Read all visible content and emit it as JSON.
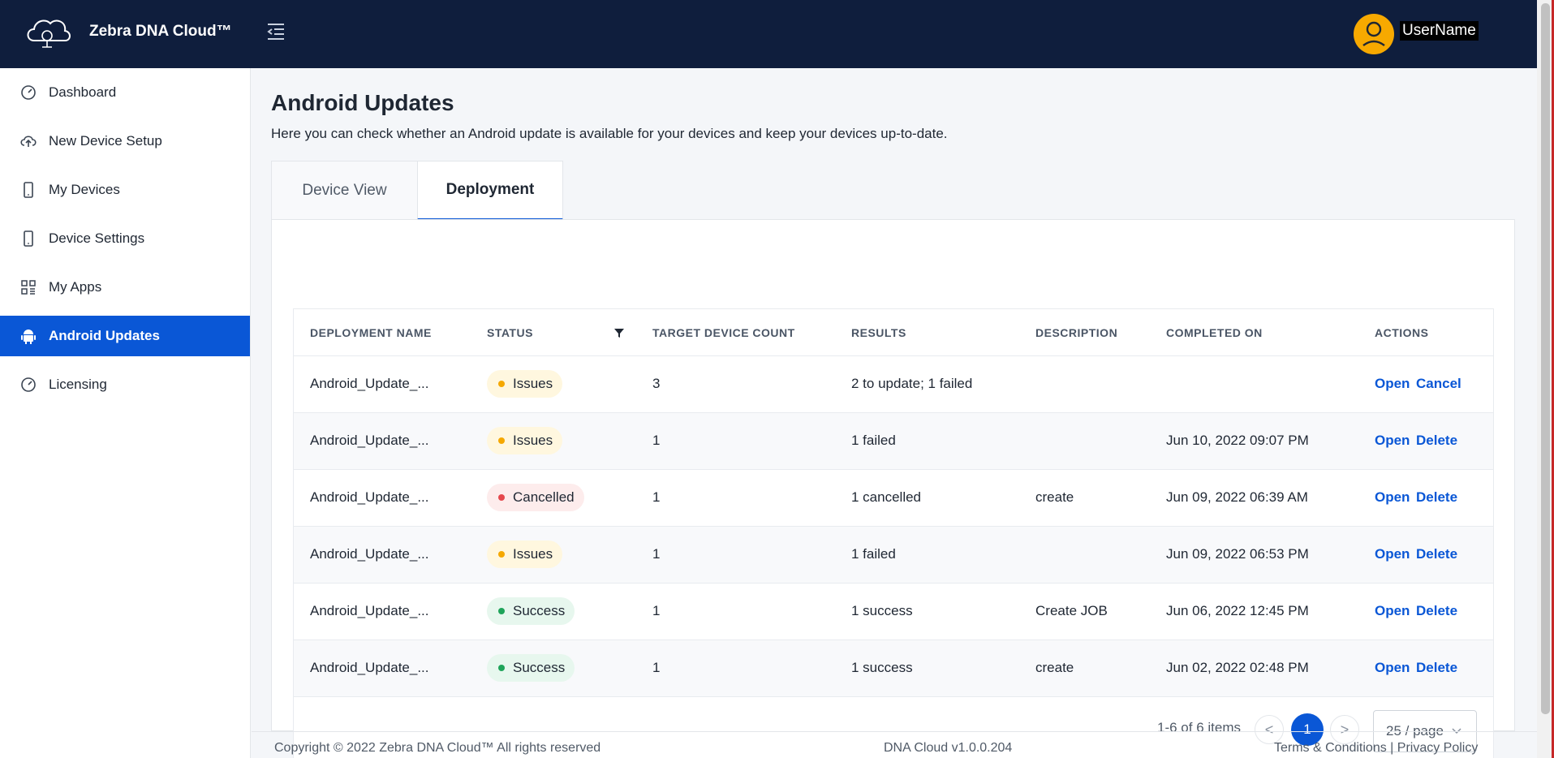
{
  "app": {
    "name": "Zebra DNA Cloud™",
    "username": "UserName"
  },
  "sidebar": {
    "items": [
      {
        "label": "Dashboard",
        "icon": "gauge-icon"
      },
      {
        "label": "New Device Setup",
        "icon": "cloud-upload-icon"
      },
      {
        "label": "My Devices",
        "icon": "phone-icon"
      },
      {
        "label": "Device Settings",
        "icon": "phone-icon"
      },
      {
        "label": "My Apps",
        "icon": "apps-grid-icon"
      },
      {
        "label": "Android Updates",
        "icon": "android-icon",
        "active": true
      },
      {
        "label": "Licensing",
        "icon": "gauge-icon"
      }
    ]
  },
  "page": {
    "title": "Android Updates",
    "description": "Here you can check whether an Android update is available for your devices and keep your devices up-to-date."
  },
  "tabs": [
    {
      "label": "Device View"
    },
    {
      "label": "Deployment",
      "selected": true
    }
  ],
  "table": {
    "headers": {
      "name": "DEPLOYMENT NAME",
      "status": "STATUS",
      "count": "TARGET DEVICE COUNT",
      "results": "RESULTS",
      "description": "DESCRIPTION",
      "completed": "COMPLETED ON",
      "actions": "ACTIONS"
    },
    "rows": [
      {
        "name": "Android_Update_...",
        "status": "Issues",
        "count": "3",
        "results": "2 to update; 1 failed",
        "description": "",
        "completed": "",
        "open": "Open",
        "action2": "Cancel"
      },
      {
        "name": "Android_Update_...",
        "status": "Issues",
        "count": "1",
        "results": "1 failed",
        "description": "",
        "completed": "Jun 10, 2022 09:07 PM",
        "open": "Open",
        "action2": "Delete"
      },
      {
        "name": "Android_Update_...",
        "status": "Cancelled",
        "count": "1",
        "results": "1 cancelled",
        "description": "create",
        "completed": "Jun 09, 2022 06:39 AM",
        "open": "Open",
        "action2": "Delete"
      },
      {
        "name": "Android_Update_...",
        "status": "Issues",
        "count": "1",
        "results": "1 failed",
        "description": "",
        "completed": "Jun 09, 2022 06:53 PM",
        "open": "Open",
        "action2": "Delete"
      },
      {
        "name": "Android_Update_...",
        "status": "Success",
        "count": "1",
        "results": "1 success",
        "description": "Create JOB",
        "completed": "Jun 06, 2022 12:45 PM",
        "open": "Open",
        "action2": "Delete"
      },
      {
        "name": "Android_Update_...",
        "status": "Success",
        "count": "1",
        "results": "1 success",
        "description": "create",
        "completed": "Jun 02, 2022 02:48 PM",
        "open": "Open",
        "action2": "Delete"
      }
    ]
  },
  "status_colors": {
    "Issues": {
      "bg": "#fff7df",
      "dot": "#f5a800"
    },
    "Cancelled": {
      "bg": "#fdecec",
      "dot": "#e5484d"
    },
    "Success": {
      "bg": "#e7f7ee",
      "dot": "#1fa45a"
    }
  },
  "pagination": {
    "summary": "1-6 of 6 items",
    "prev": "<",
    "current": "1",
    "next": ">",
    "page_size": "25 / page"
  },
  "footer": {
    "copyright": "Copyright © 2022 Zebra DNA Cloud™ All rights reserved",
    "version": "DNA Cloud v1.0.0.204",
    "links": "Terms & Conditions  |  Privacy Policy"
  },
  "colors": {
    "header_bg": "#0f1e3d",
    "accent": "#0a57d6",
    "avatar": "#f7a900"
  }
}
